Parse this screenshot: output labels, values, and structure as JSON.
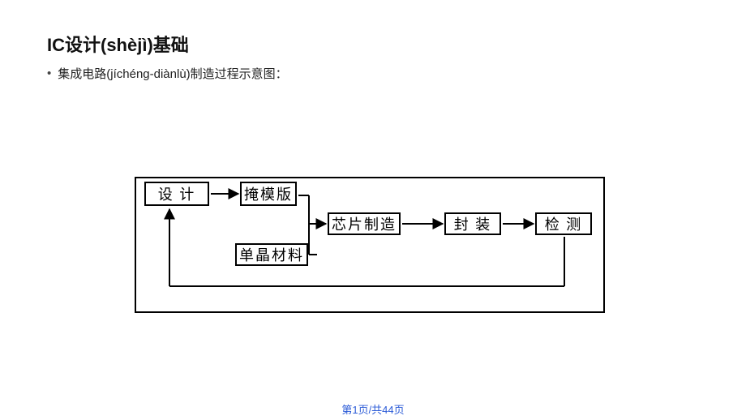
{
  "title": "IC设计(shèjì)基础",
  "subtitle": "集成电路(jíchéng-diànlù)制造过程示意图：",
  "boxes": {
    "design": "设 计",
    "mask": "掩模版",
    "mono": "单晶材料",
    "chip": "芯片制造",
    "pack": "封 装",
    "test": "检 测"
  },
  "page_label": "第1页/共44页",
  "chart_data": {
    "type": "diagram",
    "title": "集成电路制造过程示意图",
    "nodes": [
      {
        "id": "design",
        "label": "设计"
      },
      {
        "id": "mask",
        "label": "掩模版"
      },
      {
        "id": "mono",
        "label": "单晶材料"
      },
      {
        "id": "chip",
        "label": "芯片制造"
      },
      {
        "id": "pack",
        "label": "封装"
      },
      {
        "id": "test",
        "label": "检测"
      }
    ],
    "edges": [
      {
        "from": "design",
        "to": "mask"
      },
      {
        "from": "mask",
        "to": "chip"
      },
      {
        "from": "mono",
        "to": "chip"
      },
      {
        "from": "chip",
        "to": "pack"
      },
      {
        "from": "pack",
        "to": "test"
      },
      {
        "from": "test",
        "to": "design",
        "type": "feedback"
      }
    ]
  }
}
